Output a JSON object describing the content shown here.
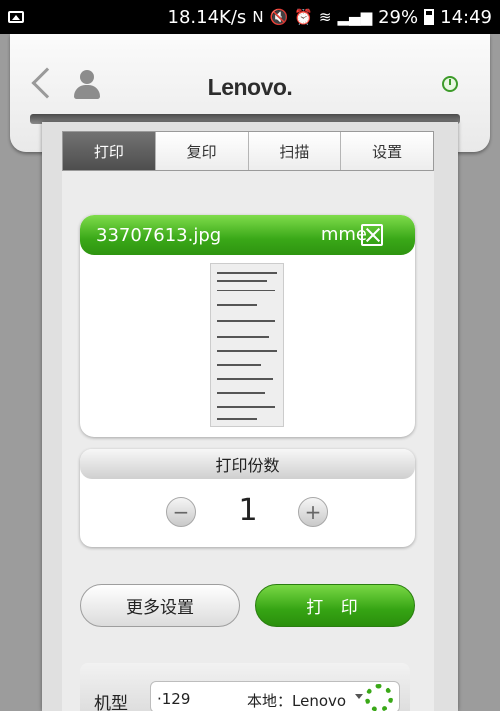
{
  "status_bar": {
    "speed": "18.14K/s",
    "icons": [
      "nfc-icon",
      "mute-icon",
      "alarm-icon",
      "wifi-icon",
      "signal-icon"
    ],
    "battery": "29%",
    "time": "14:49"
  },
  "header": {
    "brand": "Lenovo."
  },
  "tabs": [
    {
      "label": "打印"
    },
    {
      "label": "复印"
    },
    {
      "label": "扫描"
    },
    {
      "label": "设置"
    }
  ],
  "file": {
    "name": "33707613.jpg",
    "right_text": "mme"
  },
  "copies": {
    "title": "打印份数",
    "value": "1",
    "minus": "−",
    "plus": "+"
  },
  "actions": {
    "more_settings": "更多设置",
    "print": "打 印"
  },
  "model": {
    "label": "机型",
    "ip": "·129",
    "local": "本地：Lenovo"
  },
  "colors": {
    "accent_green": "#3aa818",
    "active_tab": "#5e5e5e"
  }
}
